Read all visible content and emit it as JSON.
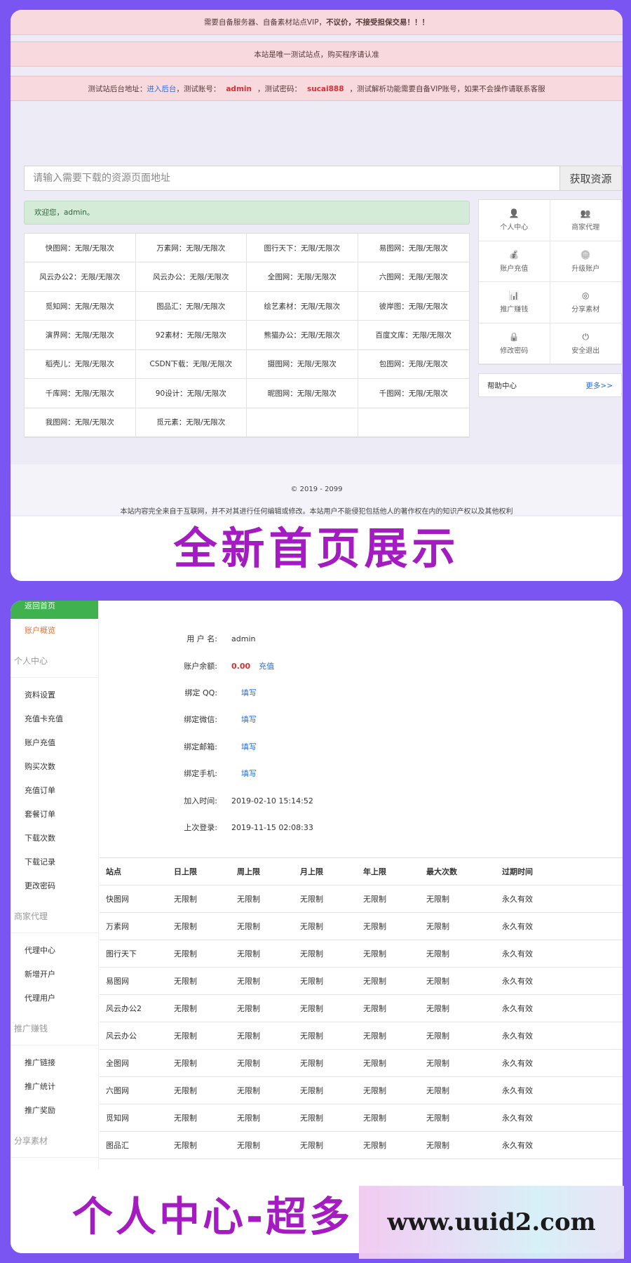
{
  "home": {
    "notices": {
      "n1_pre": "需要自备服务器、自备素材站点VIP，",
      "n1_bold": "不议价，不接受担保交易！！！",
      "n2": "本站是唯一测试站点，购买程序请认准",
      "n3_pre": "测试站后台地址：",
      "n3_link": "进入后台",
      "n3_mid1": "，测试账号：",
      "n3_user": "admin",
      "n3_mid2": "，测试密码：",
      "n3_pass": "sucai888",
      "n3_post": "，测试解析功能需要自备VIP账号，如果不会操作请联系客服"
    },
    "search": {
      "placeholder": "请输入需要下载的资源页面地址",
      "button": "获取资源"
    },
    "welcome": "欢迎您，admin。",
    "sites": [
      "快图网：无限/无限次",
      "万素网：无限/无限次",
      "图行天下：无限/无限次",
      "易图网：无限/无限次",
      "风云办公2：无限/无限次",
      "风云办公：无限/无限次",
      "全图网：无限/无限次",
      "六图网：无限/无限次",
      "觅知网：无限/无限次",
      "图品汇：无限/无限次",
      "绘艺素材：无限/无限次",
      "彼岸图：无限/无限次",
      "演界网：无限/无限次",
      "92素材：无限/无限次",
      "熊猫办公：无限/无限次",
      "百度文库：无限/无限次",
      "稻壳儿：无限/无限次",
      "CSDN下载：无限/无限次",
      "摄图网：无限/无限次",
      "包图网：无限/无限次",
      "千库网：无限/无限次",
      "90设计：无限/无限次",
      "昵图网：无限/无限次",
      "千图网：无限/无限次",
      "我图网：无限/无限次",
      "觅元素：无限/无限次",
      "",
      ""
    ],
    "side": [
      {
        "label": "个人中心",
        "icon": "user-icon"
      },
      {
        "label": "商家代理",
        "icon": "users-icon"
      },
      {
        "label": "账户充值",
        "icon": "money-bag-icon"
      },
      {
        "label": "升级账户",
        "icon": "coins-icon"
      },
      {
        "label": "推广赚钱",
        "icon": "chart-icon"
      },
      {
        "label": "分享素材",
        "icon": "globe-icon"
      },
      {
        "label": "修改密码",
        "icon": "lock-icon"
      },
      {
        "label": "安全退出",
        "icon": "power-icon"
      }
    ],
    "help": {
      "title": "帮助中心",
      "more": "更多>>"
    },
    "footer": {
      "copyright": "© 2019 - 2099",
      "disclaimer": "本站内容完全来自于互联网，并不对其进行任何编辑或修改。本站用户不能侵犯包括他人的著作权在内的知识产权以及其他权利"
    },
    "banner": "全新首页展示"
  },
  "user": {
    "nav": {
      "back": "返回首页",
      "overview": "账户概览",
      "sections": [
        {
          "title": "个人中心",
          "items": [
            "资料设置",
            "充值卡充值",
            "账户充值",
            "购买次数",
            "充值订单",
            "套餐订单",
            "下载次数",
            "下载记录",
            "更改密码"
          ]
        },
        {
          "title": "商家代理",
          "items": [
            "代理中心",
            "新增开户",
            "代理用户"
          ]
        },
        {
          "title": "推广赚钱",
          "items": [
            "推广链接",
            "推广统计",
            "推广奖励"
          ]
        },
        {
          "title": "分享素材",
          "items": []
        }
      ]
    },
    "info": {
      "username_label": "用 户 名:",
      "username": "admin",
      "balance_label": "账户余额:",
      "balance": "0.00",
      "recharge": "充值",
      "qq_label": "绑定 QQ:",
      "qq": "填写",
      "wechat_label": "绑定微信:",
      "wechat": "填写",
      "email_label": "绑定邮箱:",
      "email": "填写",
      "phone_label": "绑定手机:",
      "phone": "填写",
      "joined_label": "加入时间:",
      "joined": "2019-02-10 15:14:52",
      "last_label": "上次登录:",
      "last": "2019-11-15 02:08:33"
    },
    "table": {
      "headers": [
        "站点",
        "日上限",
        "周上限",
        "月上限",
        "年上限",
        "最大次数",
        "过期时间"
      ],
      "rows": [
        [
          "快图网",
          "无限制",
          "无限制",
          "无限制",
          "无限制",
          "无限制",
          "永久有效"
        ],
        [
          "万素网",
          "无限制",
          "无限制",
          "无限制",
          "无限制",
          "无限制",
          "永久有效"
        ],
        [
          "图行天下",
          "无限制",
          "无限制",
          "无限制",
          "无限制",
          "无限制",
          "永久有效"
        ],
        [
          "易图网",
          "无限制",
          "无限制",
          "无限制",
          "无限制",
          "无限制",
          "永久有效"
        ],
        [
          "风云办公2",
          "无限制",
          "无限制",
          "无限制",
          "无限制",
          "无限制",
          "永久有效"
        ],
        [
          "风云办公",
          "无限制",
          "无限制",
          "无限制",
          "无限制",
          "无限制",
          "永久有效"
        ],
        [
          "全图网",
          "无限制",
          "无限制",
          "无限制",
          "无限制",
          "无限制",
          "永久有效"
        ],
        [
          "六图网",
          "无限制",
          "无限制",
          "无限制",
          "无限制",
          "无限制",
          "永久有效"
        ],
        [
          "觅知网",
          "无限制",
          "无限制",
          "无限制",
          "无限制",
          "无限制",
          "永久有效"
        ],
        [
          "图品汇",
          "无限制",
          "无限制",
          "无限制",
          "无限制",
          "无限制",
          "永久有效"
        ]
      ]
    },
    "banner": "个人中心-超多"
  },
  "watermark": "www.uuid2.com",
  "colors": {
    "background": "#7b55f1",
    "banner_text": "#a51bc2",
    "link": "#2a6fd6",
    "danger": "#d83034",
    "success": "#3fb14f",
    "nav_accent": "#ea6e2d"
  }
}
